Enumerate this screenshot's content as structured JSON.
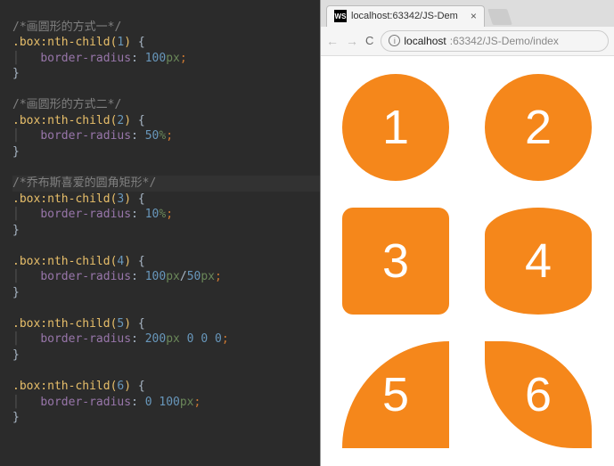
{
  "editor": {
    "comment1": "/*画圆形的方式一*/",
    "rule1_sel": ".box:nth-child(",
    "rule1_n": "1",
    "prop": "border-radius",
    "rule1_val": "100",
    "rule1_unit": "px",
    "comment2": "/*画圆形的方式二*/",
    "rule2_n": "2",
    "rule2_val": "50",
    "rule2_unit": "%",
    "comment3": "/*乔布斯喜爱的圆角矩形*/",
    "rule3_n": "3",
    "rule3_val": "10",
    "rule3_unit": "%",
    "rule4_n": "4",
    "rule4_val": "100",
    "rule4_unit": "px",
    "rule4_val2": "50",
    "rule4_unit2": "px",
    "rule5_n": "5",
    "rule5_val": "200",
    "rule5_unit": "px",
    "rule5_rest": " 0 0 0",
    "rule6_n": "6",
    "rule6_val": "0 ",
    "rule6_val2": "100",
    "rule6_unit": "px",
    "brace_open": " {",
    "brace_close": "}",
    "paren_close": ")",
    "indent_guide": "│   ",
    "colon": ": ",
    "semi": ";",
    "slash": "/"
  },
  "browser": {
    "favicon_text": "WS",
    "tab_title": "localhost:63342/JS-Dem",
    "tab_close": "×",
    "nav_back": "←",
    "nav_fwd": "→",
    "reload": "C",
    "info": "i",
    "url_host": "localhost",
    "url_port_path": ":63342/JS-Demo/index"
  },
  "page": {
    "boxes": [
      "1",
      "2",
      "3",
      "4",
      "5",
      "6"
    ]
  },
  "chart_data": {
    "type": "table",
    "title": "CSS border-radius demo",
    "rows": [
      {
        "n": 1,
        "rule": "border-radius: 100px",
        "shape": "circle"
      },
      {
        "n": 2,
        "rule": "border-radius: 50%",
        "shape": "circle"
      },
      {
        "n": 3,
        "rule": "border-radius: 10%",
        "shape": "rounded-square"
      },
      {
        "n": 4,
        "rule": "border-radius: 100px/50px",
        "shape": "superellipse"
      },
      {
        "n": 5,
        "rule": "border-radius: 200px 0 0 0",
        "shape": "quarter-circle-tl"
      },
      {
        "n": 6,
        "rule": "border-radius: 0 100px",
        "shape": "leaf"
      }
    ]
  }
}
